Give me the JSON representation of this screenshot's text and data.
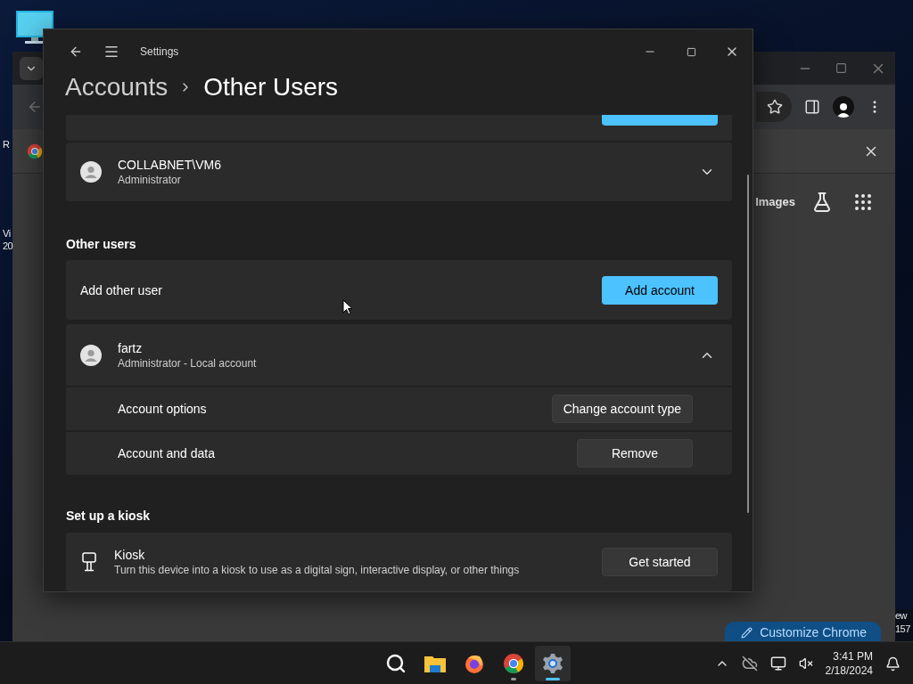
{
  "desktop": {
    "left_labels": [
      "R",
      "Vi",
      "20"
    ],
    "right_labels": [
      "ew",
      "157"
    ]
  },
  "browser": {
    "links": [
      "Images"
    ],
    "customize_button": "Customize Chrome"
  },
  "settings": {
    "title": "Settings",
    "breadcrumb": {
      "parent": "Accounts",
      "current": "Other Users"
    },
    "top_users": [
      {
        "name": "COLLABNET\\VM6",
        "role": "Administrator",
        "expanded": false
      }
    ],
    "other_users": {
      "heading": "Other users",
      "add_label": "Add other user",
      "add_button": "Add account",
      "users": [
        {
          "name": "fartz",
          "role": "Administrator - Local account",
          "expanded": true,
          "options": [
            {
              "label": "Account options",
              "button": "Change account type"
            },
            {
              "label": "Account and data",
              "button": "Remove"
            }
          ]
        }
      ]
    },
    "kiosk": {
      "heading": "Set up a kiosk",
      "title": "Kiosk",
      "description": "Turn this device into a kiosk to use as a digital sign, interactive display, or other things",
      "button": "Get started"
    }
  },
  "taskbar": {
    "apps": [
      {
        "kind": "search",
        "selected": false,
        "running": false
      },
      {
        "kind": "explorer",
        "selected": false,
        "running": false
      },
      {
        "kind": "firefox",
        "selected": false,
        "running": false
      },
      {
        "kind": "chrome",
        "selected": false,
        "running": true
      },
      {
        "kind": "settings",
        "selected": true,
        "running": true
      }
    ],
    "clock": {
      "time": "3:41 PM",
      "date": "2/18/2024"
    }
  }
}
